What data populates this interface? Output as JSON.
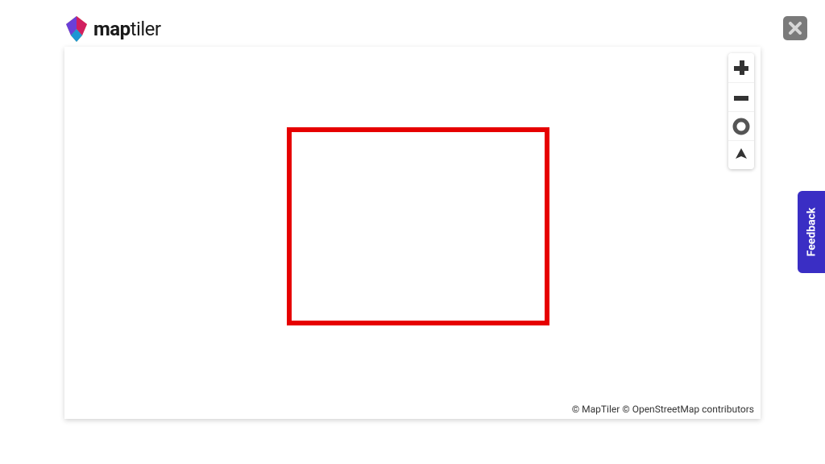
{
  "header": {
    "brand_bold": "map",
    "brand_light": "tiler"
  },
  "controls": {
    "zoom_in_icon": "plus-icon",
    "zoom_out_icon": "minus-icon",
    "geolocate_icon": "locate-icon",
    "compass_icon": "compass-icon"
  },
  "attribution": {
    "text": "© MapTiler © OpenStreetMap contributors"
  },
  "feedback": {
    "label": "Feedback"
  }
}
